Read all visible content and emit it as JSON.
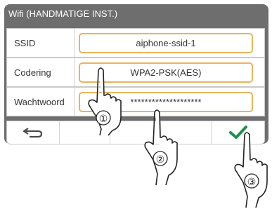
{
  "header": {
    "title": "Wifi (HANDMATIGE INST.)"
  },
  "rows": [
    {
      "label": "SSID",
      "value": "aiphone-ssid-1"
    },
    {
      "label": "Codering",
      "value": "WPA2-PSK(AES)"
    },
    {
      "label": "Wachtwoord",
      "value": "********************"
    }
  ],
  "toolbar": {
    "back_icon": "back-arrow-icon",
    "confirm_icon": "check-icon"
  },
  "callouts": [
    "①",
    "②",
    "③"
  ],
  "colors": {
    "screen_bg": "#6f6e6e",
    "field_border": "#e9b45c",
    "check": "#1e8f4e",
    "back": "#4a4a4a"
  }
}
